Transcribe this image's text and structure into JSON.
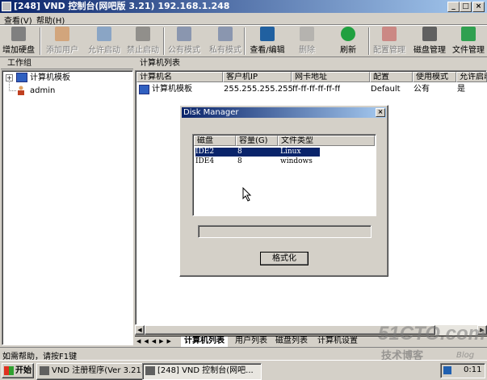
{
  "window": {
    "title": "[248] VND 控制台(网吧版 3.21) 192.168.1.248"
  },
  "menu": [
    {
      "label": "查看(V)"
    },
    {
      "label": "帮助(H)"
    }
  ],
  "toolbar": [
    {
      "label": "增加硬盘",
      "icon": "add-disk-icon",
      "enabled": true
    },
    {
      "label": "添加用户",
      "icon": "add-user-icon",
      "enabled": false
    },
    {
      "label": "允许启动",
      "icon": "allow-boot-icon",
      "enabled": false
    },
    {
      "label": "禁止启动",
      "icon": "deny-boot-icon",
      "enabled": false
    },
    {
      "label": "公有模式",
      "icon": "public-mode-icon",
      "enabled": false
    },
    {
      "label": "私有模式",
      "icon": "private-mode-icon",
      "enabled": false
    },
    {
      "label": "查看/编辑",
      "icon": "view-edit-icon",
      "enabled": true
    },
    {
      "label": "删除",
      "icon": "delete-icon",
      "enabled": false
    },
    {
      "label": "刷新",
      "icon": "refresh-icon",
      "enabled": true
    },
    {
      "label": "配置管理",
      "icon": "config-manage-icon",
      "enabled": false
    },
    {
      "label": "磁盘管理",
      "icon": "disk-manage-icon",
      "enabled": true
    },
    {
      "label": "文件管理",
      "icon": "file-manage-icon",
      "enabled": true
    }
  ],
  "left_panel": {
    "header": "工作组",
    "tree": [
      {
        "label": "计算机模板",
        "expander": "+"
      },
      {
        "label": "admin"
      }
    ]
  },
  "right_panel": {
    "header": "计算机列表",
    "columns": [
      "计算机名",
      "客户机IP",
      "网卡地址",
      "配置",
      "使用模式",
      "允许启动"
    ],
    "rows": [
      [
        "计算机模板",
        "255.255.255.255",
        "ff-ff-ff-ff-ff-ff",
        "Default",
        "公有",
        "是"
      ]
    ],
    "tabs": [
      "计算机列表",
      "用户列表",
      "磁盘列表",
      "计算机设置"
    ]
  },
  "dialog": {
    "title": "Disk Manager",
    "columns": [
      "磁盘",
      "容量(G)",
      "文件类型"
    ],
    "rows": [
      [
        "IDE2",
        "8",
        "Linux"
      ],
      [
        "IDE4",
        "8",
        "windows"
      ]
    ],
    "format_button": "格式化"
  },
  "statusbar": {
    "text": "如需帮助，请按F1键"
  },
  "taskbar": {
    "start": "开始",
    "tasks": [
      "VND 注册程序(Ver 3.21)",
      "[248] VND 控制台(网吧..."
    ],
    "clock": "0:11"
  },
  "watermark": {
    "main": "51CTO.com",
    "sub": "技术博客",
    "blog": "Blog"
  },
  "colors": {
    "title_start": "#0a246a",
    "title_end": "#a6caf0",
    "selection": "#0a246a",
    "face": "#d4d0c8"
  }
}
